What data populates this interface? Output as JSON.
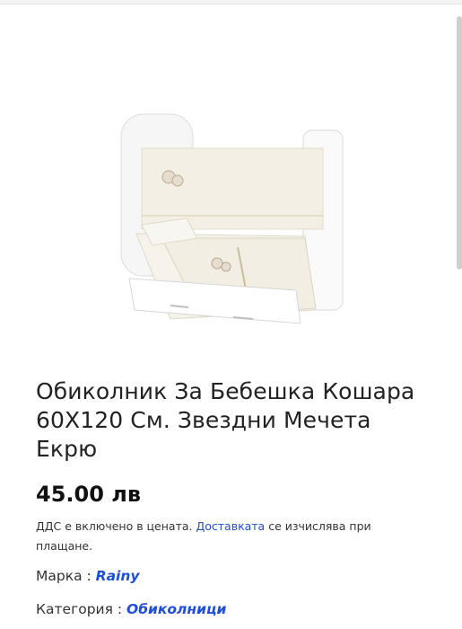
{
  "product": {
    "image_alt": "Бебешка кошара с обиколник",
    "title": "Обиколник За Бебешка Кошара 60Х120 См. Звездни Мечета Екрю",
    "price": "45.00 лв",
    "vat_before": "ДДС е включено в цената. ",
    "vat_link": "Доставката",
    "vat_after": " се изчислява при плащане.",
    "brand_label": "Марка : ",
    "brand_value": "Rainy",
    "category_label": "Категория : ",
    "category_value": "Обиколници"
  }
}
